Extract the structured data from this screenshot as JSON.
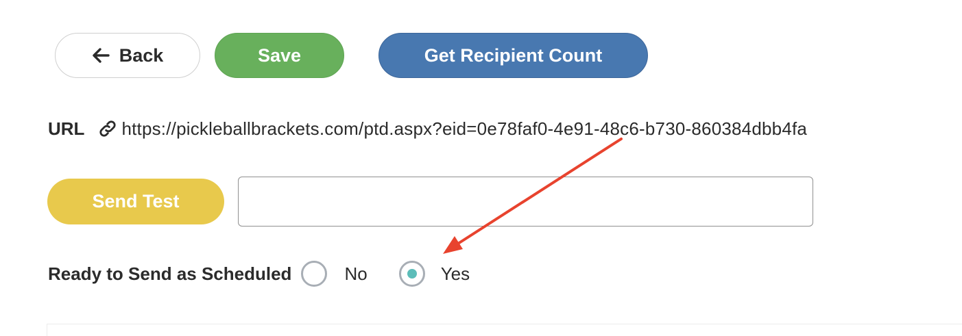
{
  "toolbar": {
    "back_label": "Back",
    "save_label": "Save",
    "recipient_count_label": "Get Recipient Count"
  },
  "url_row": {
    "label": "URL",
    "icon": "link-icon",
    "value": "https://pickleballbrackets.com/ptd.aspx?eid=0e78faf0-4e91-48c6-b730-860384dbb4fa"
  },
  "send_test": {
    "button_label": "Send Test",
    "input_value": ""
  },
  "ready_to_send": {
    "label": "Ready to Send as Scheduled",
    "options": [
      {
        "label": "No",
        "selected": false
      },
      {
        "label": "Yes",
        "selected": true
      }
    ]
  },
  "annotation": {
    "type": "arrow",
    "color": "#e8432e",
    "points_to": "ready-yes-radio"
  },
  "colors": {
    "save": "#68b05c",
    "recipient_count": "#4878b0",
    "send_test": "#e8c94c",
    "radio_selected": "#5cbdb9"
  }
}
